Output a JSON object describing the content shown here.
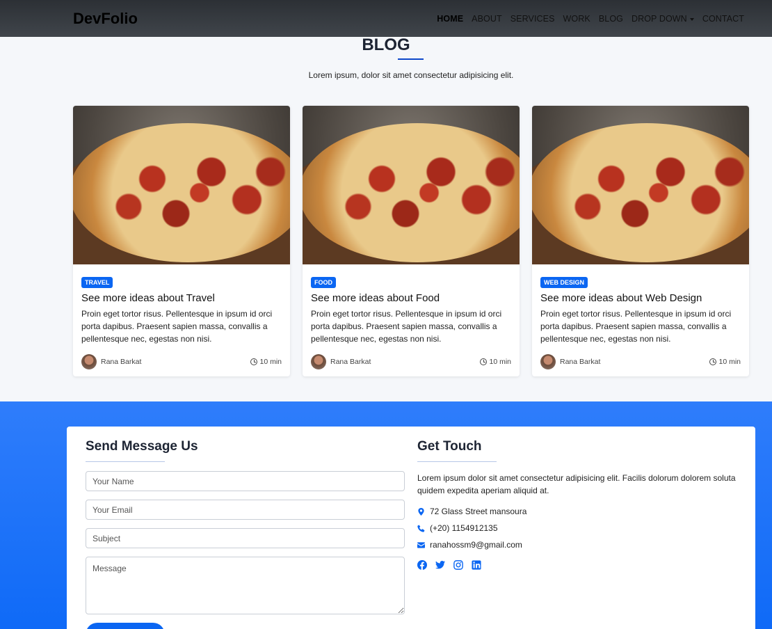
{
  "navbar": {
    "brand": "DevFolio",
    "items": [
      "HOME",
      "ABOUT",
      "SERVICES",
      "WORK",
      "BLOG",
      "DROP DOWN",
      "CONTACT"
    ],
    "active": "HOME"
  },
  "blog": {
    "title": "BLOG",
    "subtitle": "Lorem ipsum, dolor sit amet consectetur adipisicing elit.",
    "cards": [
      {
        "tag": "TRAVEL",
        "title": "See more ideas about Travel",
        "text": "Proin eget tortor risus. Pellentesque in ipsum id orci porta dapibus. Praesent sapien massa, convallis a pellentesque nec, egestas non nisi.",
        "author": "Rana Barkat",
        "time": "10 min"
      },
      {
        "tag": "FOOD",
        "title": "See more ideas about Food",
        "text": "Proin eget tortor risus. Pellentesque in ipsum id orci porta dapibus. Praesent sapien massa, convallis a pellentesque nec, egestas non nisi.",
        "author": "Rana Barkat",
        "time": "10 min"
      },
      {
        "tag": "WEB DESIGN",
        "title": "See more ideas about Web Design",
        "text": "Proin eget tortor risus. Pellentesque in ipsum id orci porta dapibus. Praesent sapien massa, convallis a pellentesque nec, egestas non nisi.",
        "author": "Rana Barkat",
        "time": "10 min"
      }
    ]
  },
  "contact": {
    "send_title": "Send Message Us",
    "placeholders": {
      "name": "Your Name",
      "email": "Your Email",
      "subject": "Subject",
      "message": "Message"
    },
    "get_title": "Get Touch",
    "get_text": "Lorem ipsum dolor sit amet consectetur adipisicing elit. Facilis dolorum dolorem soluta quidem expedita aperiam aliquid at.",
    "address": "72 Glass Street mansoura",
    "phone": "(+20) 1154912135",
    "email": "ranahossm9@gmail.com",
    "socials": [
      "facebook-icon",
      "twitter-icon",
      "instagram-icon",
      "linkedin-icon"
    ]
  },
  "colors": {
    "accent": "#0b66f2",
    "contact_bg": "#1a70f8",
    "navbar": "#35393e"
  }
}
